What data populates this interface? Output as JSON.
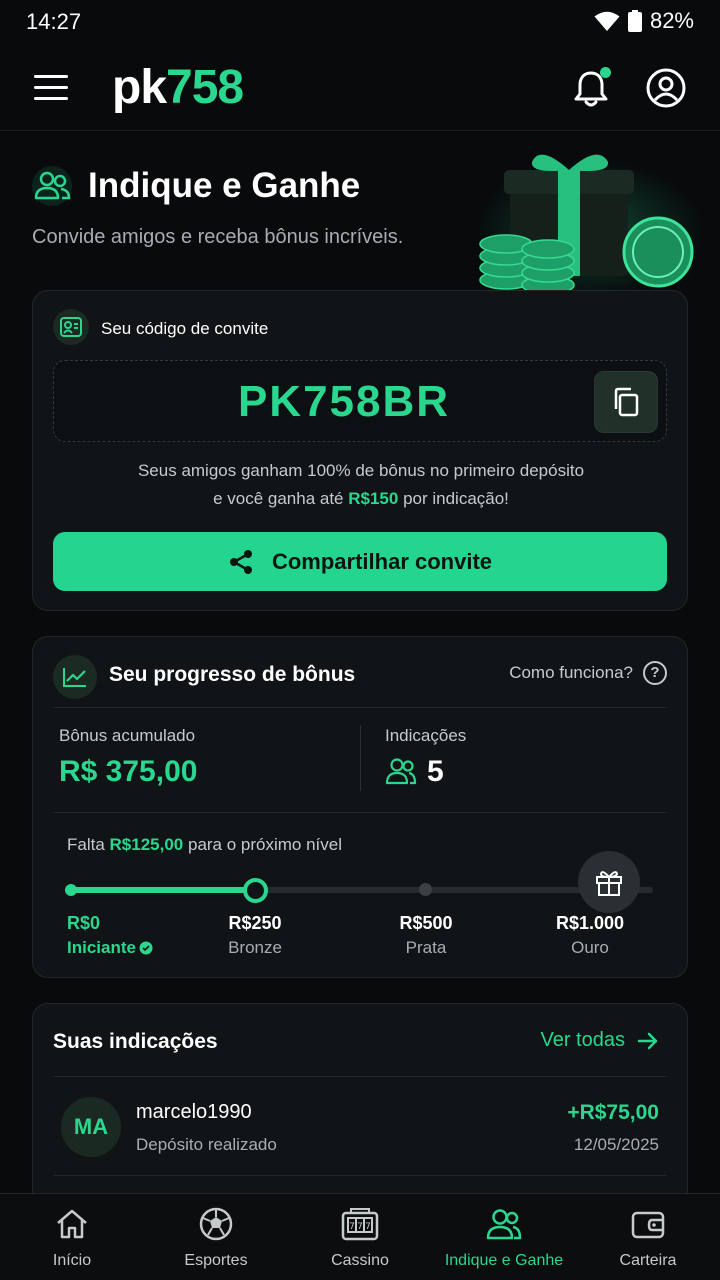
{
  "status_bar": {
    "time": "14:27",
    "battery": "82%"
  },
  "header": {
    "logo_pk": "pk",
    "logo_num": "758"
  },
  "hero": {
    "title": "Indique e Ganhe",
    "subtitle": "Convide amigos e receba bônus incríveis."
  },
  "invite": {
    "label": "Seu código de convite",
    "code": "PK758BR",
    "desc_line1": "Seus amigos ganham 100% de bônus no primeiro depósito",
    "desc_line2_pre": "e você ganha até ",
    "desc_amount": "R$150",
    "desc_line2_post": " por indicação!",
    "share_label": "Compartilhar convite"
  },
  "progress": {
    "title": "Seu progresso de bônus",
    "how_label": "Como funciona?",
    "help_glyph": "?",
    "accumulated_label": "Bônus acumulado",
    "accumulated_value": "R$ 375,00",
    "referrals_label": "Indicações",
    "referrals_count": "5",
    "next_pre": "Falta ",
    "next_amount": "R$125,00",
    "next_post": " para o próximo nível",
    "fill_percent": 32,
    "tiers": [
      {
        "value": "R$0",
        "name": "Iniciante"
      },
      {
        "value": "R$250",
        "name": "Bronze"
      },
      {
        "value": "R$500",
        "name": "Prata"
      },
      {
        "value": "R$1.000",
        "name": "Ouro"
      }
    ]
  },
  "referrals": {
    "title": "Suas indicações",
    "see_all": "Ver todas",
    "items": [
      {
        "initials": "MA",
        "name": "marcelo1990",
        "status": "Depósito realizado",
        "amount": "+R$75,00",
        "date": "12/05/2025"
      }
    ]
  },
  "nav": [
    {
      "label": "Início",
      "icon": "home-icon"
    },
    {
      "label": "Esportes",
      "icon": "soccer-ball-icon"
    },
    {
      "label": "Cassino",
      "icon": "slot-machine-icon"
    },
    {
      "label": "Indique e Ganhe",
      "icon": "users-icon",
      "active": true
    },
    {
      "label": "Carteira",
      "icon": "wallet-icon"
    }
  ],
  "colors": {
    "accent": "#2bd68e",
    "background": "#080a0c",
    "card": "#111416"
  }
}
